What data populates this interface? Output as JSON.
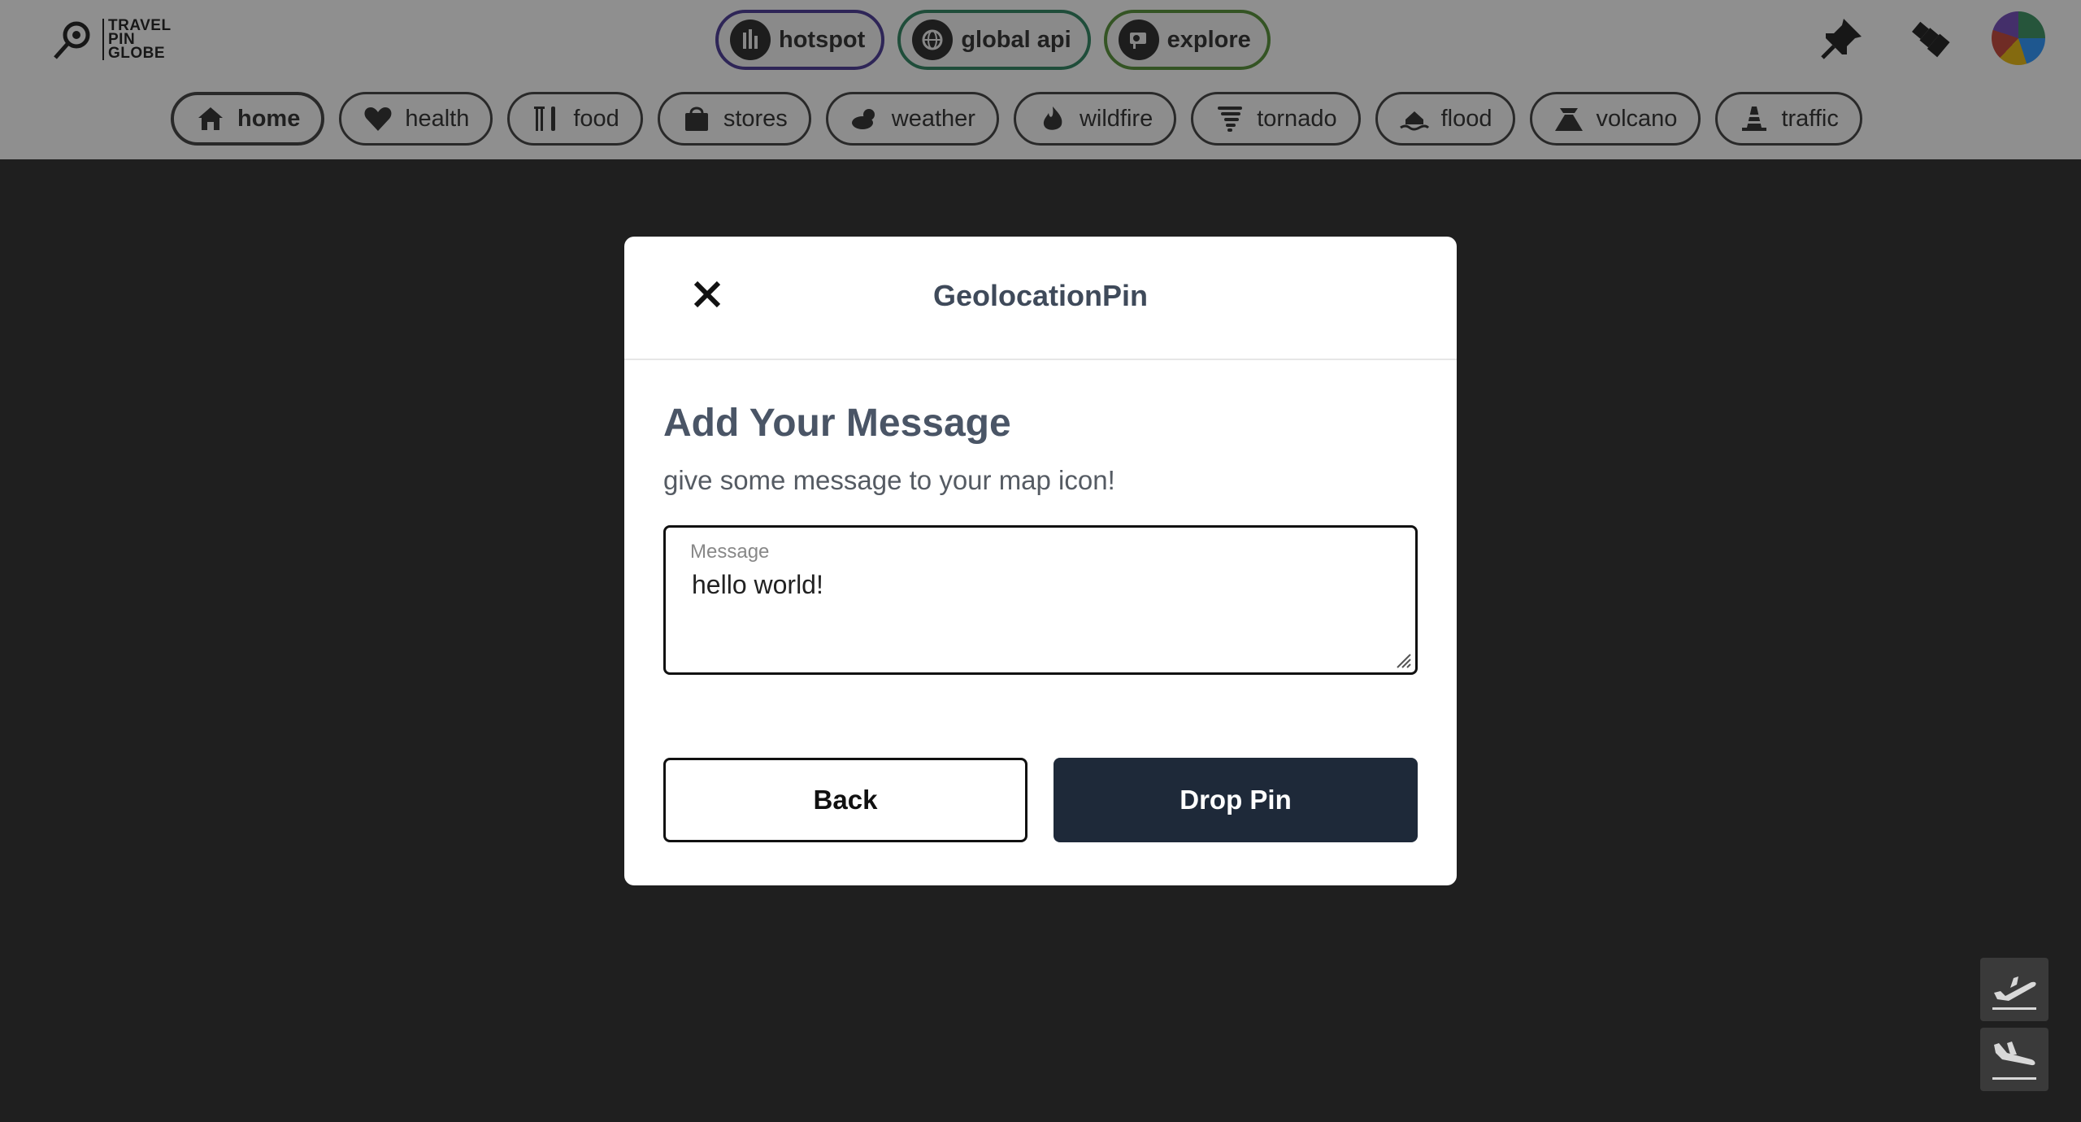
{
  "brand": {
    "lines": [
      "TRAVEL",
      "PIN",
      "GLOBE"
    ]
  },
  "modes": [
    {
      "label": "hotspot",
      "icon": "hotspot-icon"
    },
    {
      "label": "global api",
      "icon": "globe-api-icon"
    },
    {
      "label": "explore",
      "icon": "explore-icon"
    }
  ],
  "header_icons": [
    "pushpin-icon",
    "spyglass-icon",
    "avatar"
  ],
  "categories": [
    {
      "label": "home",
      "icon": "home-icon",
      "active": true
    },
    {
      "label": "health",
      "icon": "heart-icon"
    },
    {
      "label": "food",
      "icon": "utensils-icon"
    },
    {
      "label": "stores",
      "icon": "shopping-bag-icon"
    },
    {
      "label": "weather",
      "icon": "cloud-sun-icon"
    },
    {
      "label": "wildfire",
      "icon": "fire-icon"
    },
    {
      "label": "tornado",
      "icon": "tornado-icon"
    },
    {
      "label": "flood",
      "icon": "flood-icon"
    },
    {
      "label": "volcano",
      "icon": "volcano-icon"
    },
    {
      "label": "traffic",
      "icon": "traffic-cone-icon"
    }
  ],
  "modal": {
    "title": "GeolocationPin",
    "heading": "Add Your Message",
    "subtext": "give some message to your map icon!",
    "field_label": "Message",
    "field_value": "hello world!",
    "back_label": "Back",
    "drop_label": "Drop Pin"
  },
  "side_buttons": [
    "takeoff-icon",
    "landing-icon"
  ],
  "colors": {
    "primary_button": "#1e2939",
    "map_background": "#1f1f1f",
    "hotspot_border": "#3d2b8f",
    "global_border": "#1f7c55",
    "explore_border": "#4a8a2a"
  }
}
